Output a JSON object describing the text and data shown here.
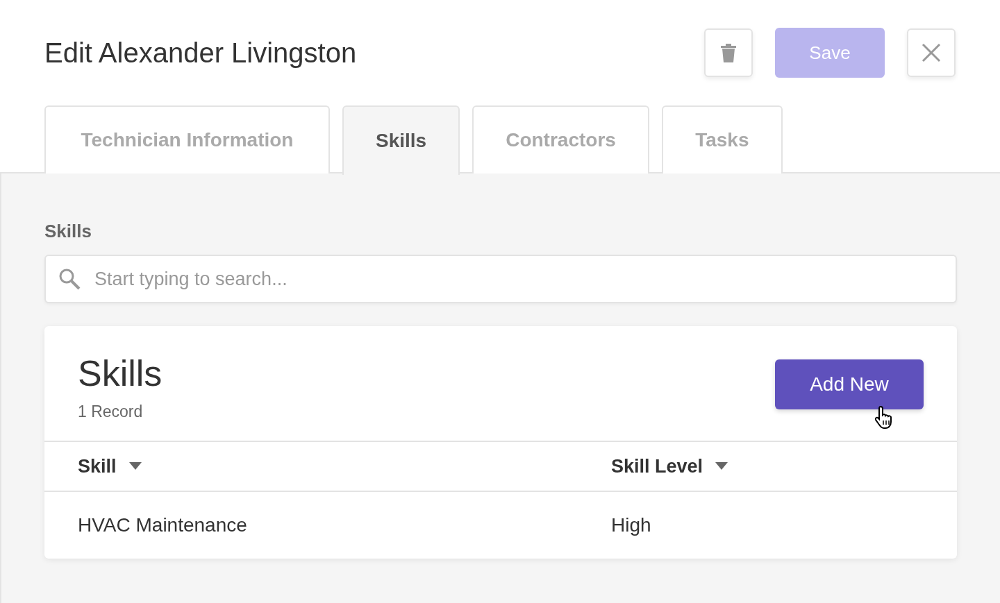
{
  "title": "Edit Alexander Livingston",
  "actions": {
    "save": {
      "label": "Save",
      "disabled": true
    }
  },
  "tabs": [
    {
      "label": "Technician Information",
      "selected": false
    },
    {
      "label": "Skills",
      "selected": true
    },
    {
      "label": "Contractors",
      "selected": false
    },
    {
      "label": "Tasks",
      "selected": false
    }
  ],
  "section_label": "Skills",
  "search": {
    "placeholder": "Start typing to search..."
  },
  "card": {
    "title": "Skills",
    "count": "1 Record",
    "add_button": "Add New",
    "columns": [
      "Skill",
      "Skill Level"
    ],
    "rows": [
      [
        "HVAC Maintenance",
        "High"
      ]
    ]
  }
}
